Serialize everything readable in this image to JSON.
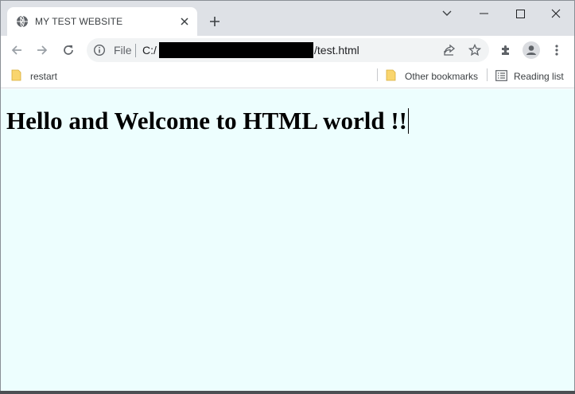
{
  "browser": {
    "tab": {
      "title": "MY TEST WEBSITE"
    },
    "address": {
      "scheme_label": "File",
      "url_prefix": "C:/",
      "url_suffix": "/test.html"
    },
    "bookmarks": {
      "left": [
        {
          "label": "restart"
        }
      ],
      "other_label": "Other bookmarks",
      "reading_list_label": "Reading list"
    }
  },
  "page": {
    "heading": "Hello and Welcome to HTML world !!"
  },
  "colors": {
    "page_background": "#edfefe",
    "tab_strip": "#dee1e6",
    "omnibox": "#f1f3f4",
    "folder_icon": "#f9d56e"
  },
  "icons": {
    "favicon": "globe-icon",
    "tab_close": "close-icon",
    "new_tab": "plus-icon",
    "tab_search": "chevron-down-icon",
    "minimize": "minimize-icon",
    "maximize": "maximize-icon",
    "close_window": "close-icon",
    "back": "arrow-left-icon",
    "forward": "arrow-right-icon",
    "reload": "reload-icon",
    "site_info": "info-icon",
    "share": "share-icon",
    "bookmark_star": "star-icon",
    "extensions": "puzzle-icon",
    "profile": "profile-icon",
    "menu": "kebab-menu-icon",
    "bookmark_folder": "folder-icon",
    "reading_list": "reading-list-icon"
  }
}
